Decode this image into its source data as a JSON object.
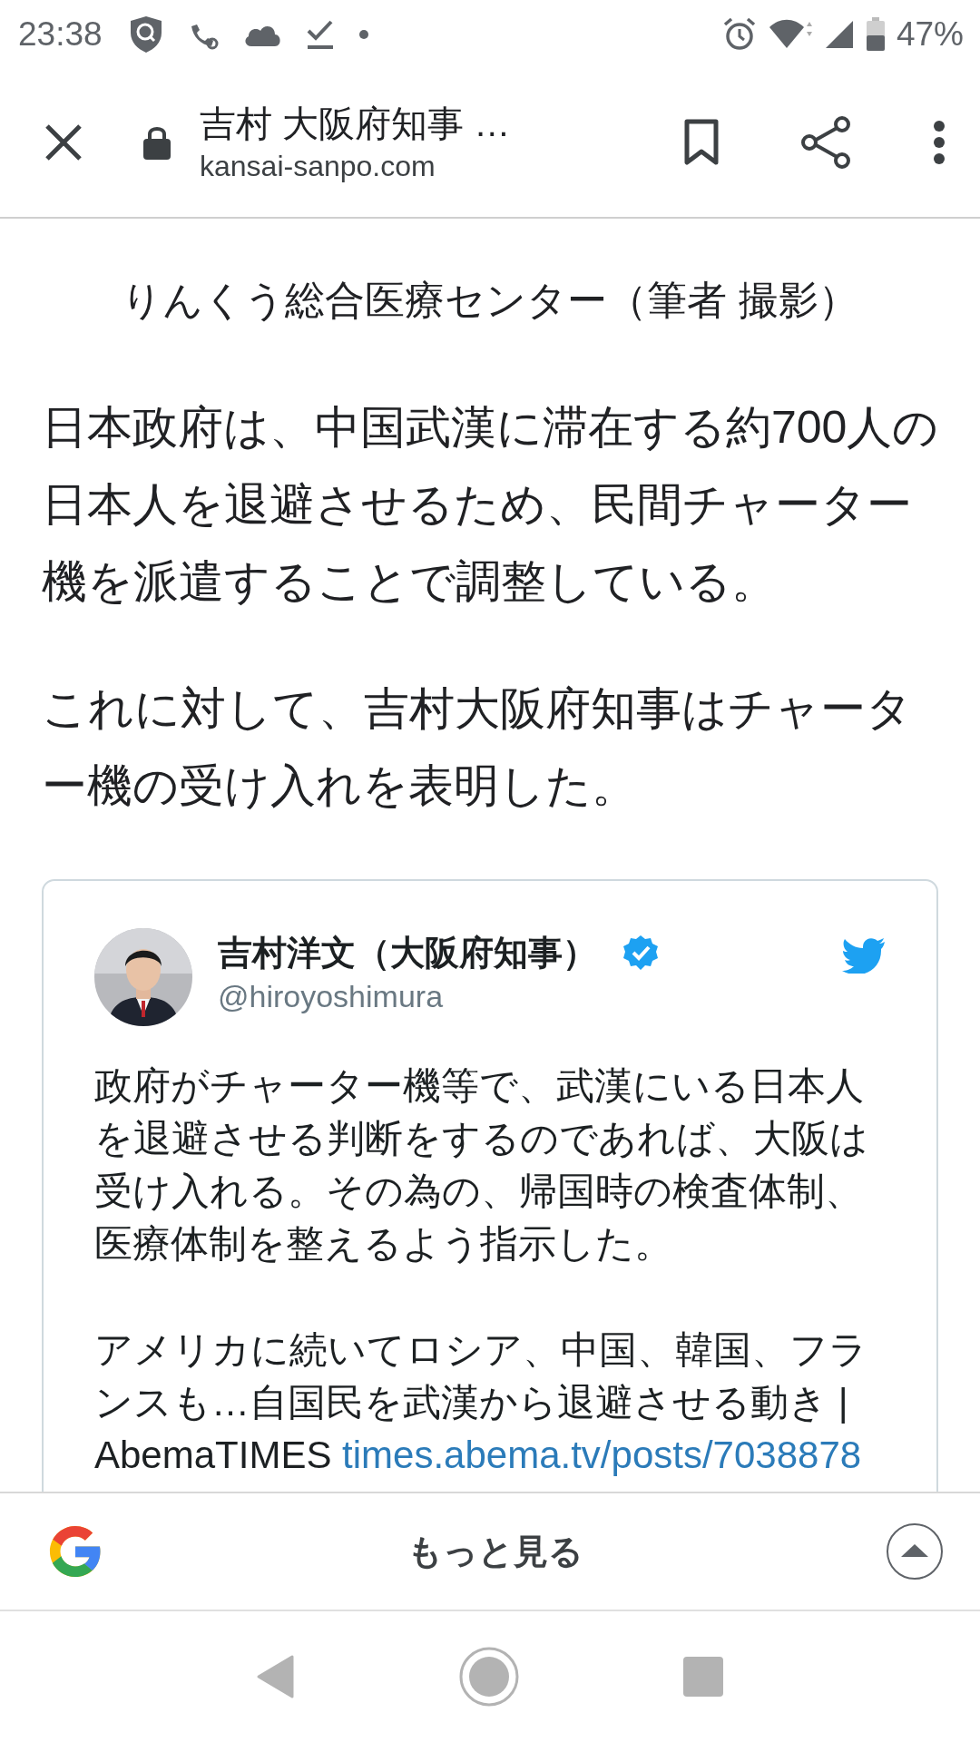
{
  "status_bar": {
    "time": "23:38",
    "battery": "47%"
  },
  "toolbar": {
    "title": "吉村 大阪府知事 …",
    "url": "kansai-sanpo.com"
  },
  "article": {
    "caption": "りんくう総合医療センター（筆者 撮影）",
    "paragraphs": [
      "日本政府は、中国武漢に滞在する約700人の日本人を退避させるため、民間チャーター機を派遣することで調整している。",
      "これに対して、吉村大阪府知事はチャーター機の受け入れを表明した。"
    ]
  },
  "tweet": {
    "name": "吉村洋文（大阪府知事）",
    "verified": true,
    "handle": "@hiroyoshimura",
    "paragraphs": [
      {
        "text": "政府がチャーター機等で、武漢にいる日本人を退避させる判断をするのであれば、大阪は受け入れる。その為の、帰国時の検査体制、医療体制を整えるよう指示した。"
      },
      {
        "text": "アメリカに続いてロシア、中国、韓国、フランスも…自国民を武漢から退避させる動き | AbemaTIMES",
        "link": "times.abema.tv/posts/7038878"
      }
    ]
  },
  "bottom_sheet": {
    "label": "もっと見る"
  }
}
